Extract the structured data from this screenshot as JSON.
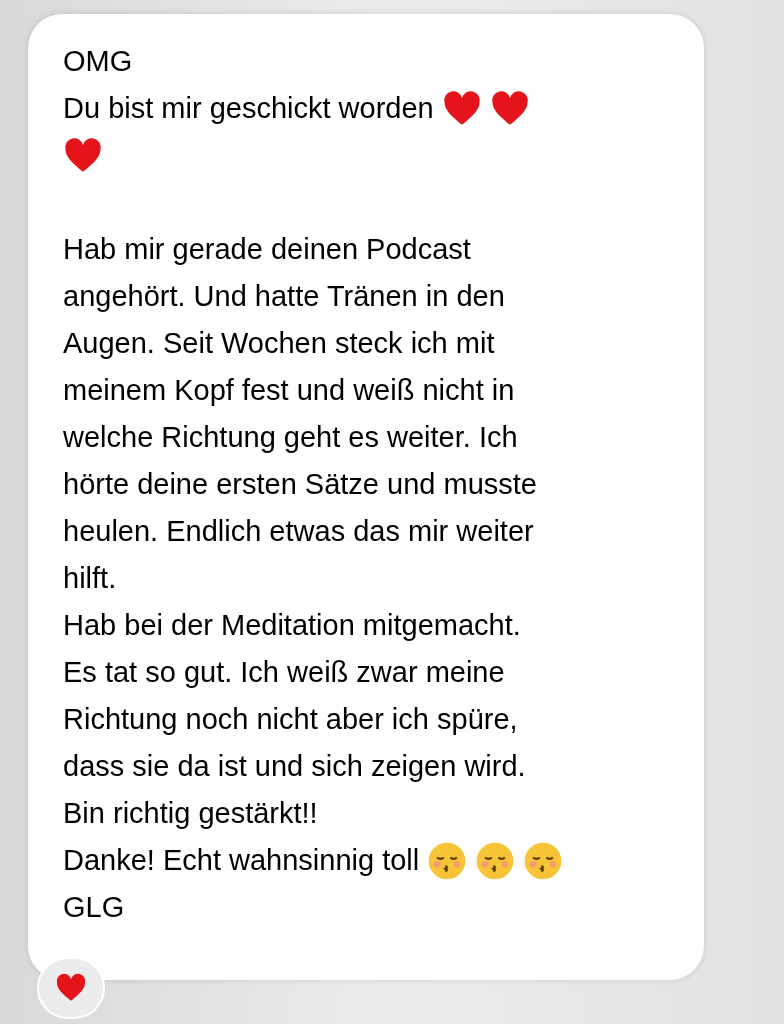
{
  "message": {
    "lines": [
      {
        "text": "OMG"
      },
      {
        "text": "Du bist mir geschickt worden",
        "emoji": [
          {
            "kind": "heart"
          },
          {
            "kind": "heart"
          }
        ]
      },
      {
        "emoji": [
          {
            "kind": "heart"
          }
        ]
      },
      {
        "text": "Hab mir gerade deinen Podcast",
        "blank_line_before": true
      },
      {
        "text": "angehört. Und hatte Tränen in den"
      },
      {
        "text": "Augen. Seit Wochen steck ich mit"
      },
      {
        "text": "meinem Kopf fest und weiß nicht in"
      },
      {
        "text": "welche Richtung geht es weiter. Ich"
      },
      {
        "text": "hörte deine ersten Sätze und musste"
      },
      {
        "text": "heulen. Endlich etwas das mir weiter"
      },
      {
        "text": "hilft."
      },
      {
        "text": "Hab bei der Meditation mitgemacht."
      },
      {
        "text": "Es tat so gut. Ich weiß zwar meine"
      },
      {
        "text": "Richtung noch nicht aber ich spüre,"
      },
      {
        "text": "dass sie da ist und sich zeigen wird."
      },
      {
        "text": "Bin richtig gestärkt!!"
      },
      {
        "text": "Danke! Echt wahnsinnig toll",
        "emoji": [
          {
            "kind": "kiss"
          },
          {
            "kind": "kiss"
          },
          {
            "kind": "kiss"
          }
        ]
      },
      {
        "text": "GLG"
      }
    ],
    "reaction": {
      "kind": "heart"
    }
  }
}
